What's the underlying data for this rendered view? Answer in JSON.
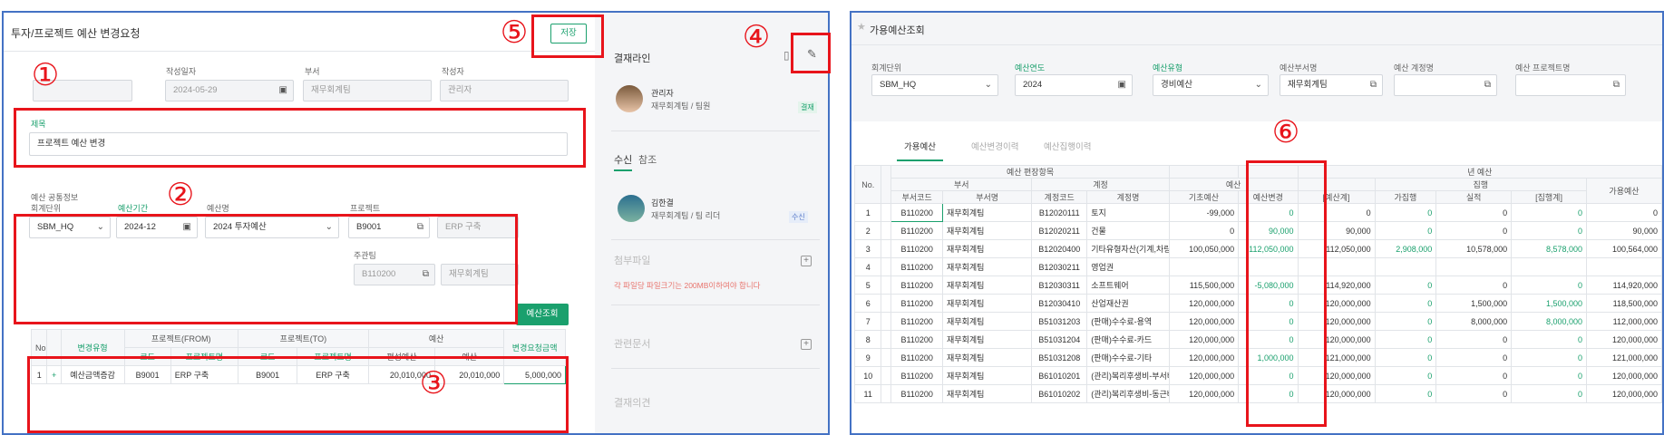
{
  "left": {
    "title": "투자/프로젝트 예산 변경요청",
    "save_label": "저장",
    "header_fields": {
      "date_label": "작성일자",
      "date_value": "2024-05-29",
      "dept_label": "부서",
      "dept_value": "재무회계팀",
      "writer_label": "작성자",
      "writer_value": "관리자"
    },
    "subject_label": "제목",
    "subject_value": "프로젝트 예산 변경",
    "section_label": "예산 공통정보",
    "common": {
      "unit_label": "회계단위",
      "unit_value": "SBM_HQ",
      "period_label": "예산기간",
      "period_value": "2024-12",
      "budget_label": "예산명",
      "budget_value": "2024 투자예산",
      "project_label": "프로젝트",
      "project_code": "B9001",
      "project_name": "ERP 구축",
      "owner_label": "주관팀",
      "owner_code": "B110200",
      "owner_name": "재무회계팀"
    },
    "query_button": "예산조회",
    "table": {
      "h_no": "No.",
      "h_type": "변경유형",
      "h_from": "프로젝트(FROM)",
      "h_to": "프로젝트(TO)",
      "h_budget": "예산",
      "h_amount": "변경요청금액",
      "h_code": "코드",
      "h_pname": "프로젝트명",
      "h_plan": "편성예산",
      "h_budget2": "예산",
      "row": {
        "no": "1",
        "type": "예산금액증감",
        "from_code": "B9001",
        "from_name": "ERP 구축",
        "to_code": "B9001",
        "to_name": "ERP 구축",
        "plan": "20,010,000",
        "budget": "20,010,000",
        "amount": "5,000,000"
      }
    }
  },
  "approval": {
    "title": "결재라인",
    "approver1": {
      "name": "관리자",
      "dept": "재무회계팀 / 팀원",
      "badge": "결재"
    },
    "tab_receive": "수신",
    "tab_ref": "참조",
    "receiver": {
      "name": "김한결",
      "dept": "재무회계팀 / 팀 리더",
      "badge": "수신"
    },
    "attach_title": "첨부파일",
    "attach_note": "각 파일당 파일크기는 200MB이하여야 합니다",
    "related_title": "관련문서",
    "opinion_title": "결재의견"
  },
  "right": {
    "title": "가용예산조회",
    "filters": {
      "unit_label": "회계단위",
      "unit_value": "SBM_HQ",
      "year_label": "예산연도",
      "year_value": "2024",
      "type_label": "예산유형",
      "type_value": "경비예산",
      "dept_label": "예산부서명",
      "dept_value": "재무회계팀",
      "acct_label": "예산 계정명",
      "acct_value": "",
      "proj_label": "예산 프로젝트명",
      "proj_value": ""
    },
    "tabs": [
      "가용예산",
      "예산변경이력",
      "예산집행이력"
    ],
    "headers": {
      "no": "No.",
      "group1": "예산 편장항목",
      "group2": "예산",
      "group3": "년 예산",
      "dept": "부서",
      "account": "계정",
      "exec": "집행",
      "avail": "가용예산",
      "dept_code": "부서코드",
      "dept_name": "부서명",
      "acct_code": "계정코드",
      "acct_name": "계정명",
      "base": "기초예산",
      "change": "예산변경",
      "sum": "[예산계]",
      "pre": "가집행",
      "actual": "실적",
      "exec_sum": "[집행계]"
    },
    "rows": [
      {
        "no": "1",
        "dc": "B110200",
        "dn": "재무회계팀",
        "ac": "B12020111",
        "an": "토지",
        "base": "-99,000",
        "chg": "0",
        "sum": "0",
        "pre": "0",
        "act": "0",
        "es": "0",
        "av": "0"
      },
      {
        "no": "2",
        "dc": "B110200",
        "dn": "재무회계팀",
        "ac": "B12020211",
        "an": "건물",
        "base": "0",
        "chg": "90,000",
        "sum": "90,000",
        "pre": "0",
        "act": "0",
        "es": "0",
        "av": "90,000"
      },
      {
        "no": "3",
        "dc": "B110200",
        "dn": "재무회계팀",
        "ac": "B12020400",
        "an": "기타유형자산(기계,차량,비...",
        "base": "100,050,000",
        "chg": "112,050,000",
        "sum": "112,050,000",
        "pre": "2,908,000",
        "act": "10,578,000",
        "es": "8,578,000",
        "av": "100,564,000"
      },
      {
        "no": "4",
        "dc": "B110200",
        "dn": "재무회계팀",
        "ac": "B12030211",
        "an": "영업권",
        "base": "",
        "chg": "",
        "sum": "",
        "pre": "",
        "act": "",
        "es": "",
        "av": ""
      },
      {
        "no": "5",
        "dc": "B110200",
        "dn": "재무회계팀",
        "ac": "B12030311",
        "an": "소프트웨어",
        "base": "115,500,000",
        "chg": "-5,080,000",
        "sum": "114,920,000",
        "pre": "0",
        "act": "0",
        "es": "0",
        "av": "114,920,000"
      },
      {
        "no": "6",
        "dc": "B110200",
        "dn": "재무회계팀",
        "ac": "B12030410",
        "an": "산업재산권",
        "base": "120,000,000",
        "chg": "0",
        "sum": "120,000,000",
        "pre": "0",
        "act": "1,500,000",
        "es": "1,500,000",
        "av": "118,500,000"
      },
      {
        "no": "7",
        "dc": "B110200",
        "dn": "재무회계팀",
        "ac": "B51031203",
        "an": "(판매)수수료-용역",
        "base": "120,000,000",
        "chg": "0",
        "sum": "120,000,000",
        "pre": "0",
        "act": "8,000,000",
        "es": "8,000,000",
        "av": "112,000,000"
      },
      {
        "no": "8",
        "dc": "B110200",
        "dn": "재무회계팀",
        "ac": "B51031204",
        "an": "(판매)수수료-카드",
        "base": "120,000,000",
        "chg": "0",
        "sum": "120,000,000",
        "pre": "0",
        "act": "0",
        "es": "0",
        "av": "120,000,000"
      },
      {
        "no": "9",
        "dc": "B110200",
        "dn": "재무회계팀",
        "ac": "B51031208",
        "an": "(판매)수수료-기타",
        "base": "120,000,000",
        "chg": "1,000,000",
        "sum": "121,000,000",
        "pre": "0",
        "act": "0",
        "es": "0",
        "av": "121,000,000"
      },
      {
        "no": "10",
        "dc": "B110200",
        "dn": "재무회계팀",
        "ac": "B61010201",
        "an": "(관리)복리후생비-부서비",
        "base": "120,000,000",
        "chg": "0",
        "sum": "120,000,000",
        "pre": "0",
        "act": "0",
        "es": "0",
        "av": "120,000,000"
      },
      {
        "no": "11",
        "dc": "B110200",
        "dn": "재무회계팀",
        "ac": "B61010202",
        "an": "(관리)복리후생비-동근버스비",
        "base": "120,000,000",
        "chg": "0",
        "sum": "120,000,000",
        "pre": "0",
        "act": "0",
        "es": "0",
        "av": "120,000,000"
      }
    ]
  },
  "markers": [
    "①",
    "②",
    "③",
    "④",
    "⑤",
    "⑥"
  ],
  "colors": {
    "accent": "#1aa06d",
    "annotation": "#e8141b",
    "panel_border": "#4472c4"
  },
  "icons": [
    "calendar-icon",
    "chevron-down-icon",
    "copy-icon",
    "edit-icon",
    "clipboard-icon",
    "plus-icon",
    "star-icon"
  ]
}
